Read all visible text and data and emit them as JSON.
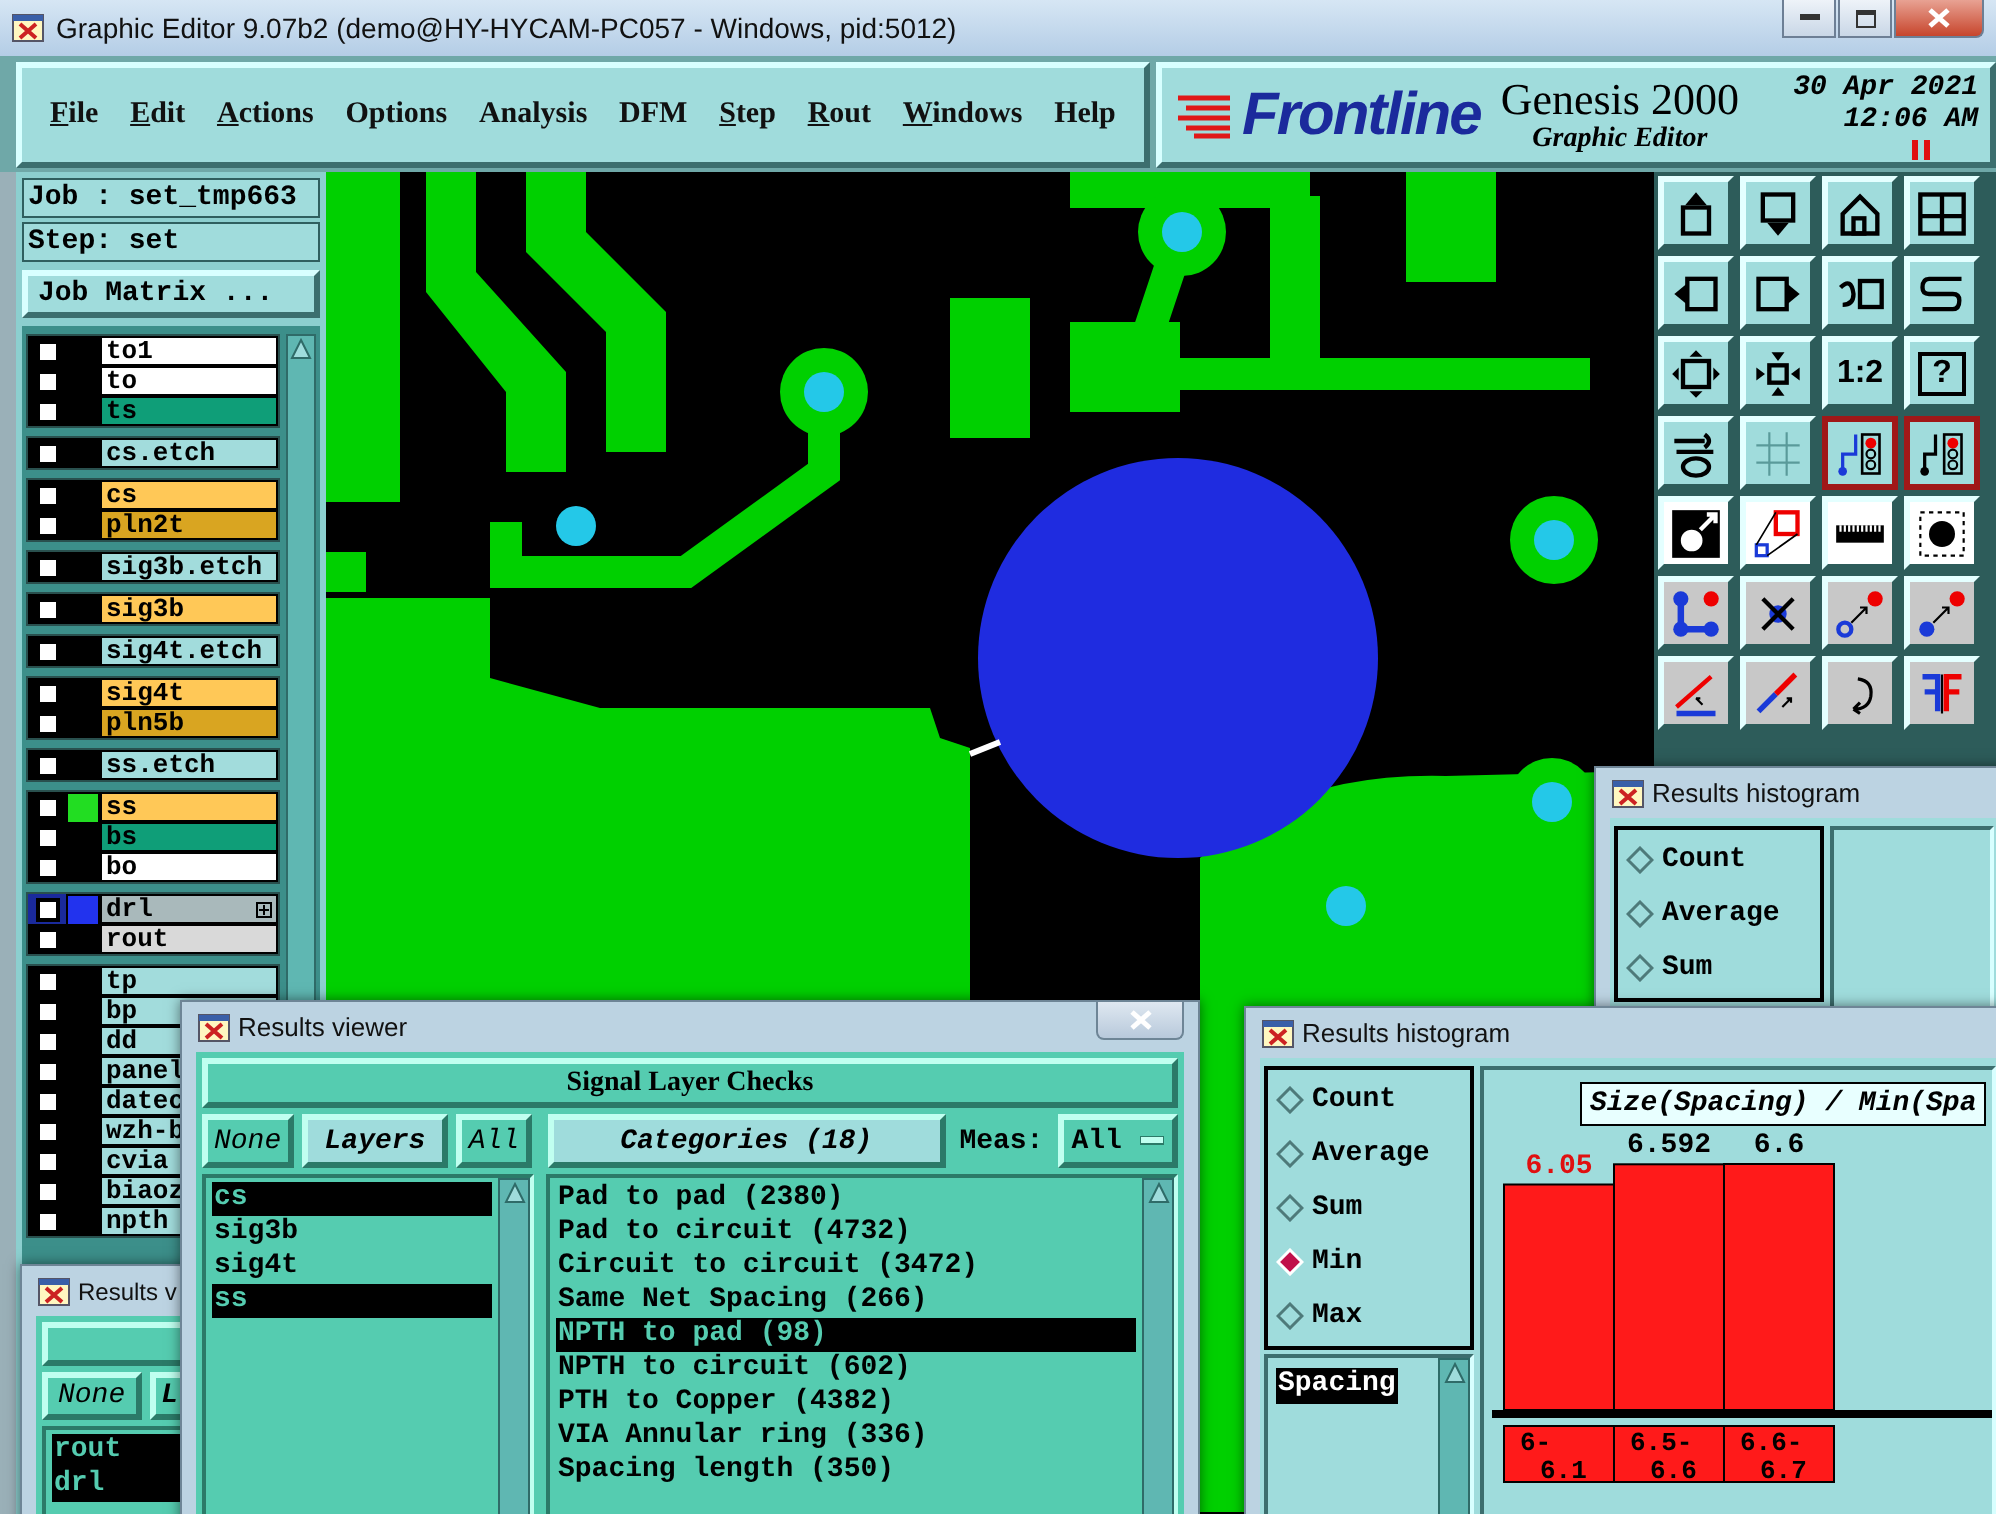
{
  "window": {
    "title": "Graphic Editor 9.07b2 (demo@HY-HYCAM-PC057 - Windows, pid:5012)"
  },
  "menu": [
    {
      "label": "File",
      "underlined": true
    },
    {
      "label": "Edit",
      "underlined": true
    },
    {
      "label": "Actions",
      "underlined": true
    },
    {
      "label": "Options",
      "underlined": false
    },
    {
      "label": "Analysis",
      "underlined": false
    },
    {
      "label": "DFM",
      "underlined": false
    },
    {
      "label": "Step",
      "underlined": true
    },
    {
      "label": "Rout",
      "underlined": true
    },
    {
      "label": "Windows",
      "underlined": true
    },
    {
      "label": "Help",
      "underlined": false
    }
  ],
  "brand": {
    "logo": "Frontline",
    "product": "Genesis 2000",
    "subtitle": "Graphic Editor",
    "date": "30 Apr 2021",
    "time": "12:06 AM"
  },
  "job": {
    "job": "Job : set_tmp663",
    "step": "Step: set",
    "matrix_button": "Job Matrix ..."
  },
  "layer_groups": [
    {
      "layers": [
        {
          "name": "to1",
          "color": "#ffffff",
          "checked": false,
          "selected": false
        },
        {
          "name": "to",
          "color": "#ffffff",
          "checked": false,
          "selected": false
        },
        {
          "name": "ts",
          "color": "#0f9e78",
          "checked": false,
          "selected": false
        }
      ]
    },
    {
      "layers": [
        {
          "name": "cs.etch",
          "color": "#a2dcdc",
          "checked": false,
          "selected": false
        }
      ]
    },
    {
      "layers": [
        {
          "name": "cs",
          "color": "#ffc857",
          "checked": false,
          "selected": false
        },
        {
          "name": "pln2t",
          "color": "#d9a521",
          "checked": false,
          "selected": false
        }
      ]
    },
    {
      "layers": [
        {
          "name": "sig3b.etch",
          "color": "#a2dcdc",
          "checked": false,
          "selected": false
        }
      ]
    },
    {
      "layers": [
        {
          "name": "sig3b",
          "color": "#ffc857",
          "checked": false,
          "selected": false
        }
      ]
    },
    {
      "layers": [
        {
          "name": "sig4t.etch",
          "color": "#a2dcdc",
          "checked": false,
          "selected": false
        }
      ]
    },
    {
      "layers": [
        {
          "name": "sig4t",
          "color": "#ffc857",
          "checked": false,
          "selected": false
        },
        {
          "name": "pln5b",
          "color": "#d9a521",
          "checked": false,
          "selected": false
        }
      ]
    },
    {
      "layers": [
        {
          "name": "ss.etch",
          "color": "#a2dcdc",
          "checked": false,
          "selected": false
        }
      ]
    },
    {
      "layers": [
        {
          "name": "ss",
          "color": "#ffc857",
          "swatch": {
            "color": "#22dd22"
          },
          "checked": false,
          "selected": false
        },
        {
          "name": "bs",
          "color": "#0f9e78",
          "checked": false,
          "selected": false
        },
        {
          "name": "bo",
          "color": "#ffffff",
          "checked": false,
          "selected": false
        }
      ]
    },
    {
      "layers": [
        {
          "name": "drl",
          "color": "#a9b9bb",
          "swatch": {
            "color": "#2233ee"
          },
          "checked": false,
          "selected": true,
          "expandable": true
        },
        {
          "name": "rout",
          "color": "#d9d9d9",
          "checked": false,
          "selected": false
        }
      ]
    },
    {
      "layers": [
        {
          "name": "tp",
          "color": "#a2dcdc",
          "checked": false,
          "selected": false
        },
        {
          "name": "bp",
          "color": "#a2dcdc",
          "checked": false,
          "selected": false
        },
        {
          "name": "dd",
          "color": "#a2dcdc",
          "checked": false,
          "selected": false
        },
        {
          "name": "panel",
          "color": "#a2dcdc",
          "checked": false,
          "selected": false
        },
        {
          "name": "datec",
          "color": "#a2dcdc",
          "checked": false,
          "selected": false
        },
        {
          "name": "wzh-b",
          "color": "#a2dcdc",
          "checked": false,
          "selected": false
        },
        {
          "name": "cvia",
          "color": "#a2dcdc",
          "checked": false,
          "selected": false
        },
        {
          "name": "biaoz",
          "color": "#a2dcdc",
          "checked": false,
          "selected": false
        },
        {
          "name": "npth",
          "color": "#a2dcdc",
          "checked": false,
          "selected": false
        }
      ]
    }
  ],
  "tools": [
    {
      "kind": "up-arrow",
      "on": false
    },
    {
      "kind": "down-arrow",
      "on": false
    },
    {
      "kind": "house",
      "on": false
    },
    {
      "kind": "xy-grid",
      "on": false
    },
    {
      "kind": "left-arrow",
      "on": false
    },
    {
      "kind": "right-arrow",
      "on": false
    },
    {
      "kind": "undo",
      "on": false
    },
    {
      "kind": "s-curve",
      "on": false
    },
    {
      "kind": "expand",
      "on": false
    },
    {
      "kind": "shrink",
      "on": false
    },
    {
      "kind": "label",
      "label": "1:2",
      "on": false
    },
    {
      "kind": "boxed-label",
      "label": "?",
      "on": false
    },
    {
      "kind": "tools",
      "on": false
    },
    {
      "kind": "grid",
      "on": false
    },
    {
      "kind": "net-left",
      "on": true
    },
    {
      "kind": "net-right",
      "on": true
    },
    {
      "kind": "snap-circle",
      "on": false
    },
    {
      "kind": "zoom-square",
      "on": false
    },
    {
      "kind": "ruler",
      "on": false
    },
    {
      "kind": "pad",
      "on": false
    },
    {
      "kind": "nodes",
      "on": false
    },
    {
      "kind": "cross",
      "on": false
    },
    {
      "kind": "hollow-point",
      "on": false
    },
    {
      "kind": "solid-point",
      "on": false
    },
    {
      "kind": "angle-line",
      "on": false
    },
    {
      "kind": "diagonal-line",
      "on": false
    },
    {
      "kind": "rotate",
      "on": false
    },
    {
      "kind": "mirror",
      "on": false
    }
  ],
  "results_viewer_back": {
    "title": "Results v",
    "none_button": "None",
    "layers_button": "L",
    "layers": [
      {
        "name": "rout",
        "selected": true
      },
      {
        "name": "drl",
        "selected": true
      }
    ]
  },
  "results_viewer": {
    "title": "Results viewer",
    "heading": "Signal Layer Checks",
    "none_button": "None",
    "layers_button": "Layers",
    "all_button": "All",
    "categories_button": "Categories (18)",
    "meas_label": "Meas:",
    "meas_value": "All",
    "layers": [
      {
        "name": "cs",
        "selected": true
      },
      {
        "name": "sig3b",
        "selected": false
      },
      {
        "name": "sig4t",
        "selected": false
      },
      {
        "name": "ss",
        "selected": true
      }
    ],
    "categories": [
      {
        "label": "Pad to pad (2380)",
        "selected": false
      },
      {
        "label": "Pad to circuit (4732)",
        "selected": false
      },
      {
        "label": "Circuit to circuit (3472)",
        "selected": false
      },
      {
        "label": "Same Net Spacing (266)",
        "selected": false
      },
      {
        "label": "NPTH to pad (98)",
        "selected": true
      },
      {
        "label": "NPTH to circuit (602)",
        "selected": false
      },
      {
        "label": "PTH to Copper (4382)",
        "selected": false
      },
      {
        "label": "VIA Annular ring (336)",
        "selected": false
      },
      {
        "label": "Spacing length (350)",
        "selected": false
      }
    ]
  },
  "histogram_back": {
    "title": "Results histogram",
    "modes": [
      {
        "label": "Count",
        "selected": false
      },
      {
        "label": "Average",
        "selected": false
      },
      {
        "label": "Sum",
        "selected": false
      }
    ]
  },
  "histogram": {
    "title": "Results histogram",
    "modes": [
      {
        "label": "Count",
        "selected": false
      },
      {
        "label": "Average",
        "selected": false
      },
      {
        "label": "Sum",
        "selected": false
      },
      {
        "label": "Min",
        "selected": true
      },
      {
        "label": "Max",
        "selected": false
      }
    ],
    "fields": [
      {
        "label": "Spacing",
        "selected": true
      }
    ],
    "chart_data": {
      "type": "bar",
      "title": "Size(Spacing) / Min(Spa",
      "categories": [
        "6-6.1",
        "6.5-6.6",
        "6.6-6.7"
      ],
      "values": [
        6.05,
        6.592,
        6.6
      ],
      "data_labels": true
    }
  }
}
